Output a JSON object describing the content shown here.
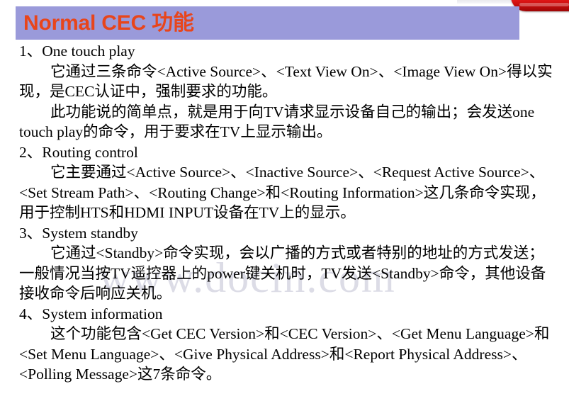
{
  "slide": {
    "title": "Normal CEC 功能",
    "title_color": "#e8451b",
    "banner_color": "#9a9ada",
    "background_color": "#ffffff",
    "watermark": "www.docin.com",
    "corner_accent_color": "#e71717",
    "body": {
      "sections": [
        {
          "heading": "1、One touch play",
          "paragraphs": [
            "它通过三条命令<Active Source>、<Text View On>、<Image View On>得以实现，是CEC认证中，强制要求的功能。",
            "此功能说的简单点，就是用于向TV请求显示设备自己的输出；会发送one touch play的命令，用于要求在TV上显示输出。"
          ]
        },
        {
          "heading": "2、Routing control",
          "paragraphs": [
            "它主要通过<Active Source>、<Inactive Source>、<Request Active Source>、<Set Stream Path>、<Routing Change>和<Routing Information>这几条命令实现，用于控制HTS和HDMI INPUT设备在TV上的显示。"
          ]
        },
        {
          "heading": "3、System standby",
          "paragraphs": [
            "它通过<Standby>命令实现，会以广播的方式或者特别的地址的方式发送；一般情况当按TV遥控器上的power键关机时，TV发送<Standby>命令，其他设备接收命令后响应关机。"
          ]
        },
        {
          "heading": "4、System information",
          "paragraphs": [
            "这个功能包含<Get CEC Version>和<CEC Version>、<Get Menu Language>和<Set Menu Language>、<Give Physical Address>和<Report Physical Address>、<Polling Message>这7条命令。"
          ]
        }
      ]
    }
  }
}
